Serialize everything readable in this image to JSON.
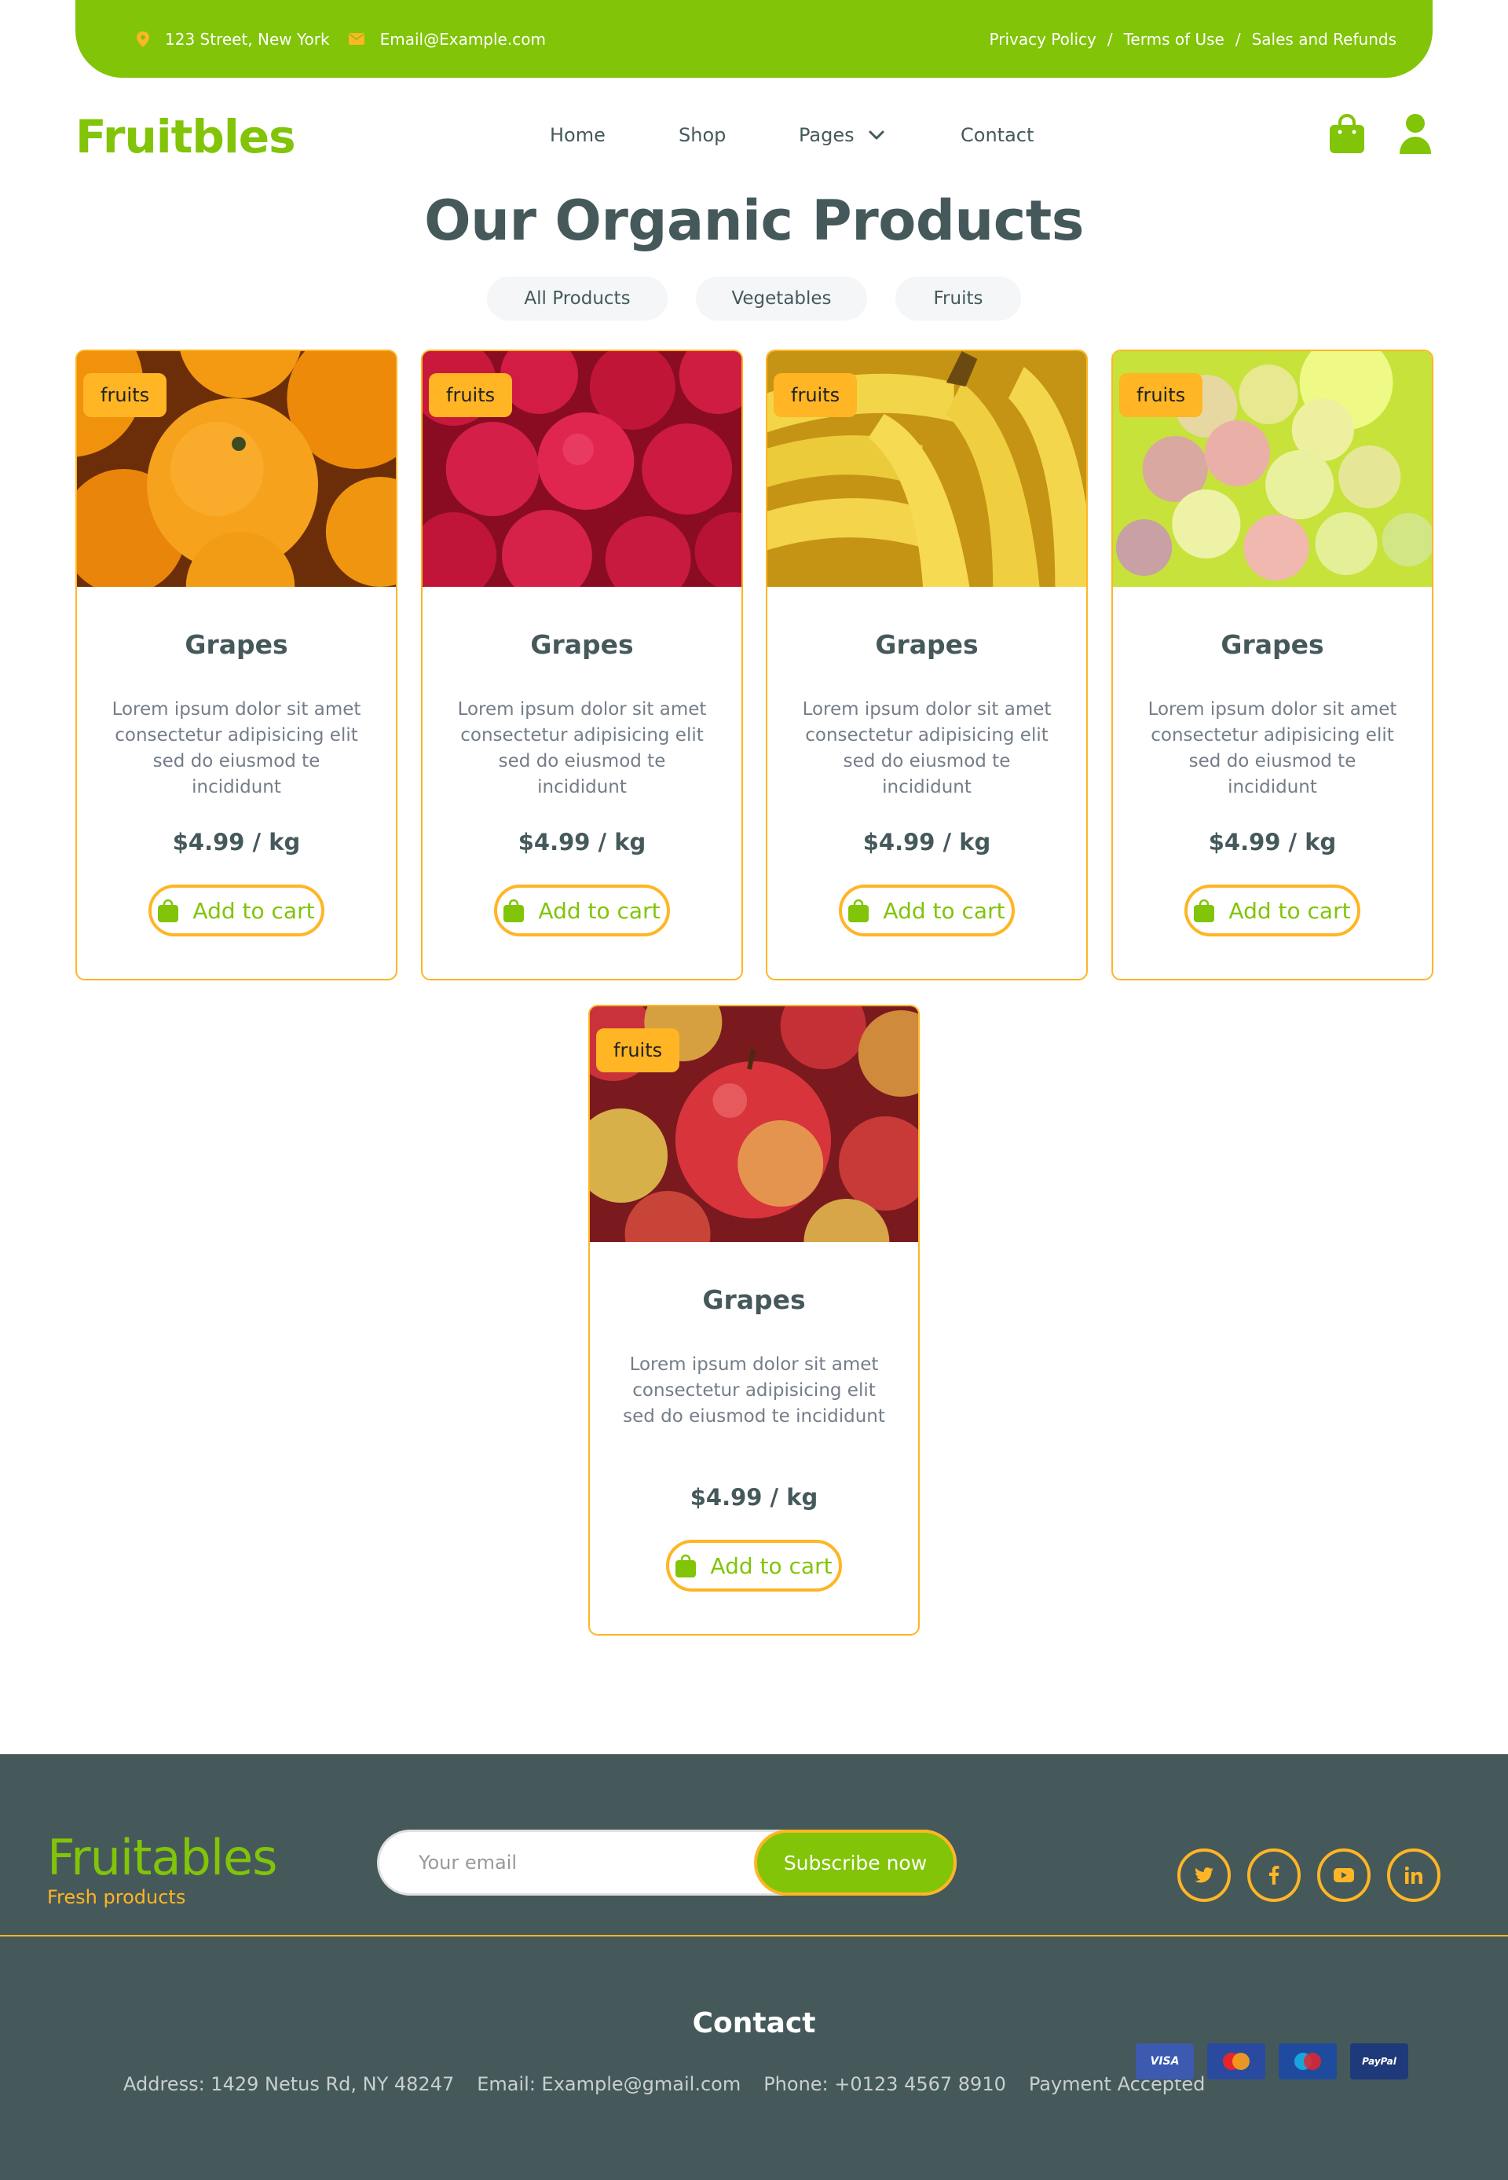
{
  "topbar": {
    "address": "123 Street, New York",
    "email": "Email@Example.com",
    "links": [
      "Privacy Policy",
      "Terms of Use",
      "Sales and Refunds"
    ],
    "separator": "/"
  },
  "nav": {
    "brand": "Fruitbles",
    "items": [
      "Home",
      "Shop",
      "Pages",
      "Contact"
    ]
  },
  "section": {
    "title": "Our Organic Products",
    "tabs": [
      "All Products",
      "Vegetables",
      "Fruits"
    ]
  },
  "products": [
    {
      "badge": "fruits",
      "name": "Grapes",
      "image": "oranges",
      "description": "Lorem ipsum dolor sit amet consectetur adipisicing elit sed do eiusmod te incididunt",
      "price": "$4.99 / kg",
      "button": "Add to cart"
    },
    {
      "badge": "fruits",
      "name": "Grapes",
      "image": "raspberries",
      "description": "Lorem ipsum dolor sit amet consectetur adipisicing elit sed do eiusmod te incididunt",
      "price": "$4.99 / kg",
      "button": "Add to cart"
    },
    {
      "badge": "fruits",
      "name": "Grapes",
      "image": "bananas",
      "description": "Lorem ipsum dolor sit amet consectetur adipisicing elit sed do eiusmod te incididunt",
      "price": "$4.99 / kg",
      "button": "Add to cart"
    },
    {
      "badge": "fruits",
      "name": "Grapes",
      "image": "grapes",
      "description": "Lorem ipsum dolor sit amet consectetur adipisicing elit sed do eiusmod te incididunt",
      "price": "$4.99 / kg",
      "button": "Add to cart"
    },
    {
      "badge": "fruits",
      "name": "Grapes",
      "image": "apples",
      "description": "Lorem ipsum dolor sit amet consectetur adipisicing elit sed do eiusmod te incididunt",
      "price": "$4.99 / kg",
      "button": "Add to cart"
    }
  ],
  "footer": {
    "brand": "Fruitables",
    "tagline": "Fresh products",
    "email_placeholder": "Your email",
    "subscribe": "Subscribe now",
    "social_icons": [
      "twitter-icon",
      "facebook-icon",
      "youtube-icon",
      "linkedin-icon"
    ],
    "contact_heading": "Contact",
    "address": "Address: 1429 Netus Rd, NY 48247",
    "email": "Email: Example@gmail.com",
    "phone": "Phone: +0123 4567 8910",
    "payment": "Payment Accepted",
    "payment_cards": [
      "VISA",
      "Mastercard",
      "Maestro",
      "PayPal"
    ]
  },
  "colors": {
    "primary": "#81c408",
    "secondary": "#ffb524",
    "dark": "#45595b",
    "text_muted": "#747d88"
  }
}
